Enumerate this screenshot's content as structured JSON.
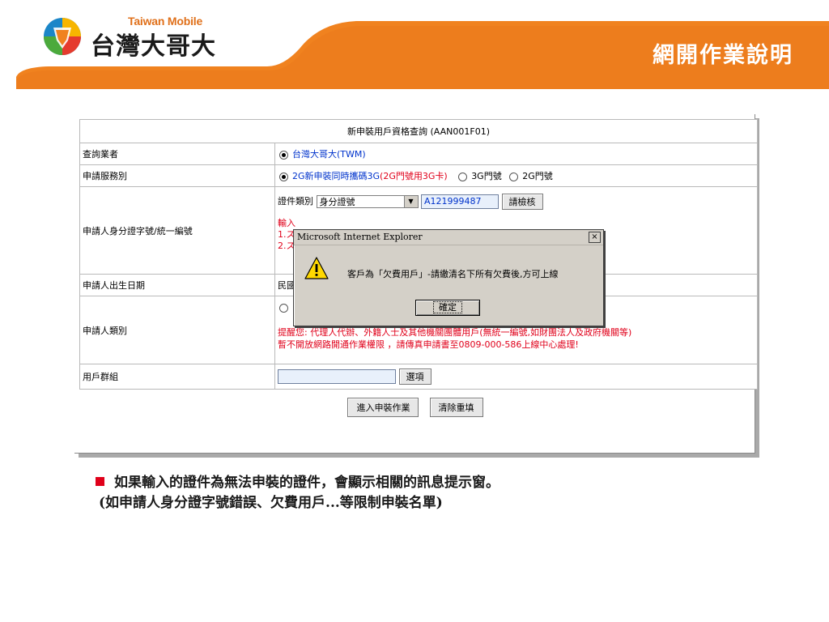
{
  "header": {
    "brand_en": "Taiwan Mobile",
    "brand_zh": "台灣大哥大",
    "slide_title": "網開作業說明"
  },
  "colors": {
    "banner_orange": "#f0821f",
    "header_row_blue": "#bcd4ef",
    "alert_red": "#e0001a",
    "link_blue": "#0033cc"
  },
  "form": {
    "title": "新申裝用戶資格查詢 (AAN001F01)",
    "rows": {
      "operator": {
        "label": "查詢業者",
        "option": "台灣大哥大(TWM)"
      },
      "service": {
        "label": "申請服務別",
        "option1_prefix": "2G新申裝同時攜碼3G",
        "option1_suffix": "(2G門號用3G卡)",
        "option2": "3G門號",
        "option3": "2G門號"
      },
      "id": {
        "label": "申請人身分證字號/統一編號",
        "doc_type_label": "證件類別",
        "doc_type_value": "身分證號",
        "id_value": "A121999487",
        "check_button": "請檢核",
        "hint1": "輸入",
        "hint2": "1.ス",
        "hint3": "2.ス"
      },
      "birth": {
        "label": "申請人出生日期",
        "value_prefix": "民國"
      },
      "category": {
        "label": "申請人類別",
        "notice1": "提醒您: 代理人代辦、外籍人士及其他機關團體用戶(無統一編號,如財團法人及政府機關等)",
        "notice2": "暫不開放網路開通作業權限 ，請傳真申請書至0809-000-586上線中心處理!"
      },
      "group": {
        "label": "用戶群組",
        "select_button": "選項"
      }
    },
    "buttons": {
      "enter": "進入申裝作業",
      "reset": "清除重填"
    }
  },
  "dialog": {
    "title": "Microsoft Internet Explorer",
    "message": "客戶為「欠費用戶」-請繳清名下所有欠費後,方可上線",
    "ok": "確定",
    "close": "×",
    "icon": "warning-icon"
  },
  "notes": {
    "line1": "如果輸入的證件為無法申裝的證件，會顯示相關的訊息提示窗。",
    "line2": "(如申請人身分證字號錯誤、欠費用戶...等限制申裝名單)"
  }
}
